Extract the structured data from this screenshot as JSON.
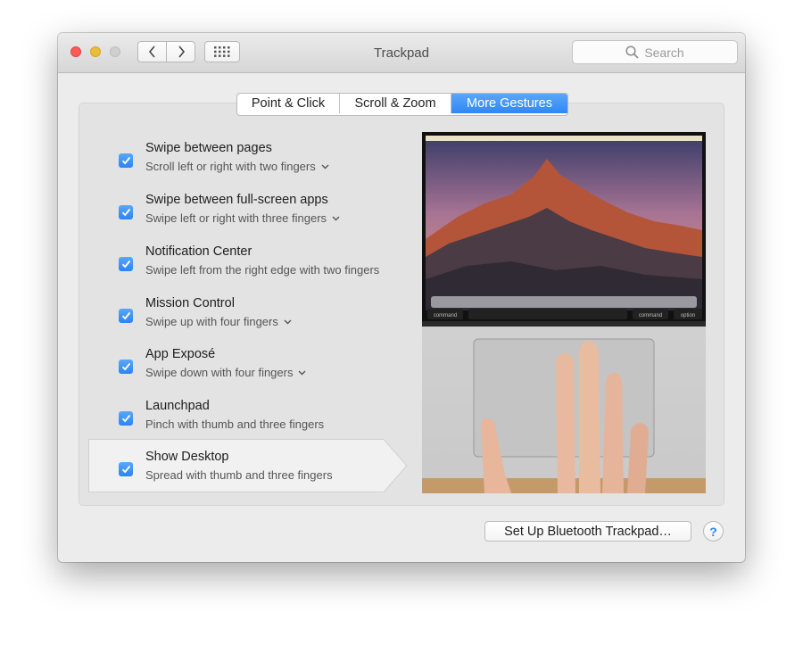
{
  "window": {
    "title": "Trackpad"
  },
  "search": {
    "placeholder": "Search"
  },
  "tabs": [
    {
      "label": "Point & Click",
      "active": false
    },
    {
      "label": "Scroll & Zoom",
      "active": false
    },
    {
      "label": "More Gestures",
      "active": true
    }
  ],
  "gestures": [
    {
      "title": "Swipe between pages",
      "subtitle": "Scroll left or right with two fingers",
      "checked": true,
      "has_menu": true
    },
    {
      "title": "Swipe between full-screen apps",
      "subtitle": "Swipe left or right with three fingers",
      "checked": true,
      "has_menu": true
    },
    {
      "title": "Notification Center",
      "subtitle": "Swipe left from the right edge with two fingers",
      "checked": true,
      "has_menu": false
    },
    {
      "title": "Mission Control",
      "subtitle": "Swipe up with four fingers",
      "checked": true,
      "has_menu": true
    },
    {
      "title": "App Exposé",
      "subtitle": "Swipe down with four fingers",
      "checked": true,
      "has_menu": true
    },
    {
      "title": "Launchpad",
      "subtitle": "Pinch with thumb and three fingers",
      "checked": true,
      "has_menu": false
    },
    {
      "title": "Show Desktop",
      "subtitle": "Spread with thumb and three fingers",
      "checked": true,
      "has_menu": false,
      "selected": true
    }
  ],
  "preview": {
    "key_labels": [
      "command",
      "command",
      "option"
    ]
  },
  "footer": {
    "bluetooth_button": "Set Up Bluetooth Trackpad…",
    "help_label": "?"
  },
  "colors": {
    "accent": "#2f87f5",
    "window_bg": "#ececec"
  }
}
